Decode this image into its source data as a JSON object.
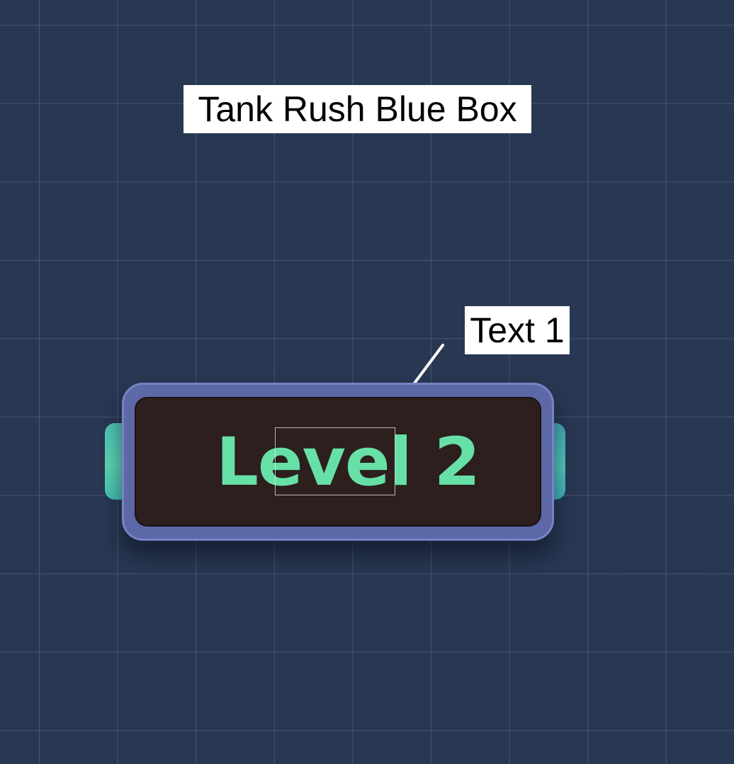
{
  "title_label": "Tank Rush Blue Box",
  "callout_label": "Text 1",
  "box": {
    "text": "Level 2"
  },
  "colors": {
    "background": "#283752",
    "box_frame": "#5c68a8",
    "box_fill": "#2c1f1e",
    "text_accent": "#67e0a7",
    "tab": "#4fc3b6"
  },
  "icons": {
    "callout_arrow": "arrow-down-left-icon"
  }
}
